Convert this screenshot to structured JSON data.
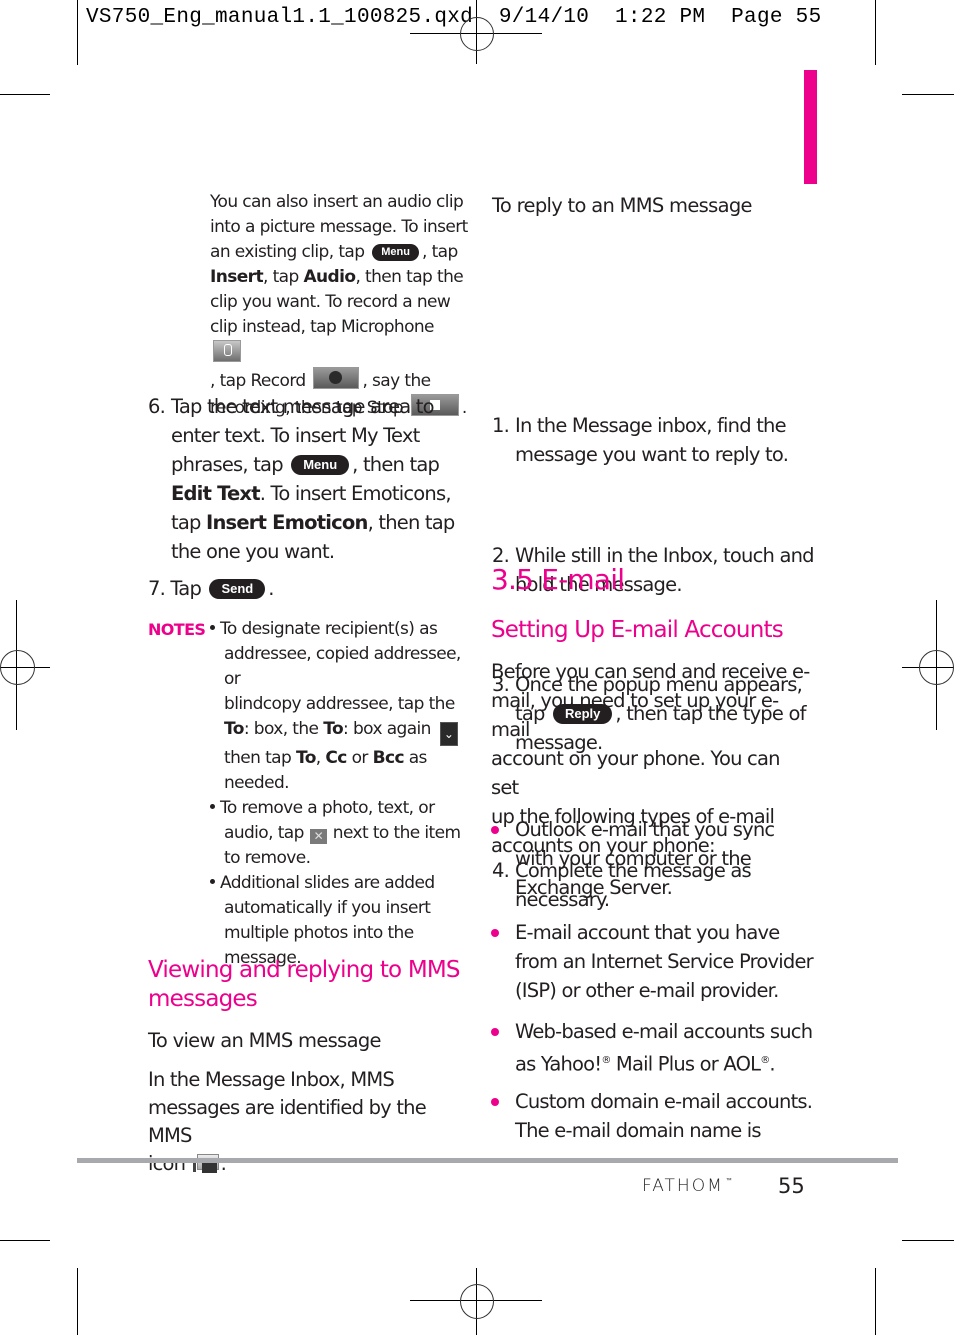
{
  "slug": {
    "filename": "VS750_Eng_manual1.1_100825.qxd",
    "date": "9/14/10",
    "time": "1:22 PM",
    "page": "Page 55"
  },
  "accent_color": "#ec008c",
  "left": {
    "audio_para": {
      "l1": "You can also insert an audio clip",
      "l2": "into a picture message. To insert",
      "l3a": "an existing clip, tap",
      "menu_btn": "Menu",
      "l3b": ", tap",
      "insert": "Insert",
      "l4a": ", tap",
      "audio": "Audio",
      "l4b": ", then tap the",
      "l5": "clip you want. To record a new",
      "l6": "clip instead, tap Microphone",
      "l7a": ", tap Record",
      "l7b": ", say the",
      "l8": "recording, then tap Stop",
      "l8b": "."
    },
    "step6": {
      "num": "6.",
      "l1": "Tap the text message area to",
      "l2": "enter text. To insert My Text",
      "l3a": "phrases, tap",
      "menu_btn": "Menu",
      "l3b": ", then tap",
      "edit_text": "Edit Text",
      "l4b": ". To insert Emoticons,",
      "l5a": "tap",
      "insert_emoticon": "Insert Emoticon",
      "l5b": ", then tap",
      "l6": "the one you want."
    },
    "step7": {
      "num": "7.",
      "label": "Tap",
      "send_btn": "Send",
      "end": "."
    },
    "notes": {
      "label": "NOTES",
      "n1": {
        "l1": "To designate recipient(s) as",
        "l2": "addressee, copied addressee, or",
        "l3": "blindcopy addressee, tap the",
        "to1": "To",
        "l4a": ": box, the",
        "to2": "To",
        "l4b": ": box again",
        "l5a": "then tap",
        "to3": "To",
        "comma": ",",
        "cc": "Cc",
        "or": "or",
        "bcc": "Bcc",
        "as": "as",
        "l6": "needed."
      },
      "n2": {
        "l1": "To remove a photo, text, or",
        "l2a": "audio, tap",
        "l2b": "next to the item",
        "l3": "to remove."
      },
      "n3": {
        "l1": "Additional slides are added",
        "l2": "automatically if you insert",
        "l3": "multiple photos into the",
        "l4": "message."
      }
    },
    "viewing_heading_l1": "Viewing and replying to MMS",
    "viewing_heading_l2": "messages",
    "view_subheading": "To view an MMS message",
    "view_para": {
      "l1": "In the Message Inbox, MMS",
      "l2": "messages are identified by the MMS",
      "l3": "icon",
      "end": "."
    }
  },
  "right": {
    "reply_subheading": "To reply to an MMS message",
    "steps": [
      {
        "num": "1.",
        "l1": "In the Message inbox, find the",
        "l2": "message you want to reply to."
      },
      {
        "num": "2.",
        "l1": "While still in the Inbox, touch and",
        "l2": "hold the message."
      },
      {
        "num": "3.",
        "l1": "Once the popup menu appears,",
        "l2a": "tap",
        "reply_btn": "Reply",
        "l2b": ", then tap the type of",
        "l3": "message."
      },
      {
        "num": "4.",
        "l1": "Complete the message as",
        "l2": "necessary."
      }
    ],
    "section_title": "3.5 E-mail",
    "setup_heading": "Setting Up E-mail Accounts",
    "setup_para": [
      "Before you can send and receive e-",
      "mail, you need to set up your e-mail",
      "account on your phone. You can set",
      "up the following types of e-mail",
      "accounts on your phone:"
    ],
    "bullets": [
      {
        "l1": "Outlook e-mail that you sync",
        "l2": "with your computer or the",
        "l3": "Exchange Server."
      },
      {
        "l1": "E-mail account that you have",
        "l2": "from an Internet Service Provider",
        "l3": "(ISP) or other e-mail provider."
      },
      {
        "l1": "Web-based e-mail accounts such",
        "l2a": "as Yahoo!",
        "reg": "®",
        "l2b": " Mail Plus or AOL",
        "reg2": "®",
        "l2c": "."
      },
      {
        "l1": "Custom domain e-mail accounts.",
        "l2": "The e-mail domain name is"
      }
    ]
  },
  "footer": {
    "brand": "FATHOM",
    "tm": "™",
    "page_number": "55"
  }
}
